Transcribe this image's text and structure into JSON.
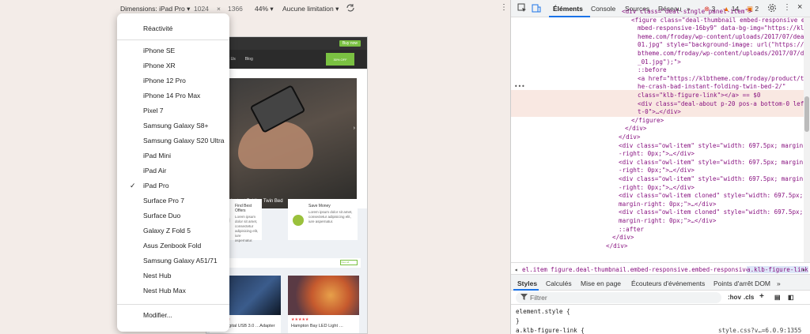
{
  "toolbar": {
    "dimensions_label": "Dimensions: iPad Pro",
    "width": "1024",
    "times": "×",
    "height": "1366",
    "zoom": "44%",
    "throttle": "Aucune limitation"
  },
  "menu": {
    "items": [
      "Réactivité",
      "iPhone SE",
      "iPhone XR",
      "iPhone 12 Pro",
      "iPhone 14 Pro Max",
      "Pixel 7",
      "Samsung Galaxy S8+",
      "Samsung Galaxy S20 Ultra",
      "iPad Mini",
      "iPad Air",
      "iPad Pro",
      "Surface Pro 7",
      "Surface Duo",
      "Galaxy Z Fold 5",
      "Asus Zenbook Fold",
      "Samsung Galaxy A51/71",
      "Nest Hub",
      "Nest Hub Max",
      "Modifier..."
    ],
    "selected": "iPad Pro",
    "check": "✓"
  },
  "site": {
    "buy": "Buy now",
    "nav": [
      "Contact Us",
      "Blog"
    ],
    "offer": "30% OFF",
    "hero_caption": "d Instant Folding Twin Bed",
    "cards": [
      {
        "title": "Find Best Offers",
        "body": "Lorem ipsum dolor sit amet, consectetur adipisicing elit, iure aspernatur."
      },
      {
        "title": "Save Money",
        "body": "Lorem ipsum dolor sit amet, consectetur adipisicing elit, iure aspernatur."
      }
    ],
    "view_all": "View all",
    "products": [
      {
        "stars": "★★★★★",
        "name": "…ern Digital USB 3.0 …Adapter"
      },
      {
        "stars": "★★★★★",
        "name": "Hampton Bay LED Light …"
      }
    ]
  },
  "devtools": {
    "tabs": [
      "Éléments",
      "Console",
      "Sources",
      "Réseau"
    ],
    "more": "»",
    "badges": {
      "errors": "3",
      "warnings": "14",
      "messages": "2"
    },
    "code_lines": [
      {
        "t": "<div class=\"deal-single panel-item\">",
        "indent": 140
      },
      {
        "t": "<figure class=\"deal-thumbnail embed-responsive e",
        "indent": 152
      },
      {
        "t": "mbed-responsive-16by9\" data-bg-img=\"https://klbt",
        "indent": 160
      },
      {
        "t": "heme.com/froday/wp-content/uploads/2017/07/deal_",
        "indent": 160
      },
      {
        "t": "01.jpg\" style=\"background-image: url(\"https://kl",
        "indent": 160
      },
      {
        "t": "btheme.com/froday/wp-content/uploads/2017/07/deal",
        "indent": 160
      },
      {
        "t": "_01.jpg\");\">",
        "indent": 160
      },
      {
        "t": "::before",
        "indent": 160
      },
      {
        "t": "<a href=\"https://klbtheme.com/froday/product/t",
        "indent": 160
      },
      {
        "t": "he-crash-bad-instant-folding-twin-bed-2/\"",
        "indent": 160
      },
      {
        "t": "class=\"klb-figure-link\"></a> == $0",
        "indent": 160
      },
      {
        "t": "<div class=\"deal-about p-20 pos-a bottom-0 lef",
        "indent": 160
      },
      {
        "t": "t-0\">…</div>",
        "indent": 160
      },
      {
        "t": "</figure>",
        "indent": 152
      },
      {
        "t": "</div>",
        "indent": 144
      },
      {
        "t": "</div>",
        "indent": 136
      },
      {
        "t": "<div class=\"owl-item\" style=\"width: 697.5px; margin",
        "indent": 136
      },
      {
        "t": "-right: 0px;\">…</div>",
        "indent": 136
      },
      {
        "t": "<div class=\"owl-item\" style=\"width: 697.5px; margin",
        "indent": 136
      },
      {
        "t": "-right: 0px;\">…</div>",
        "indent": 136
      },
      {
        "t": "<div class=\"owl-item\" style=\"width: 697.5px; margin",
        "indent": 136
      },
      {
        "t": "-right: 0px;\">…</div>",
        "indent": 136
      },
      {
        "t": "<div class=\"owl-item cloned\" style=\"width: 697.5px;",
        "indent": 136
      },
      {
        "t": "margin-right: 0px;\">…</div>",
        "indent": 136
      },
      {
        "t": "<div class=\"owl-item cloned\" style=\"width: 697.5px;",
        "indent": 136
      },
      {
        "t": "margin-right: 0px;\">…</div>",
        "indent": 136
      },
      {
        "t": "::after",
        "indent": 136
      },
      {
        "t": "</div>",
        "indent": 128
      },
      {
        "t": "</div>",
        "indent": 120
      }
    ],
    "breadcrumb": [
      "el.item",
      "figure.deal-thumbnail.embed-responsive.embed-responsive-16by9",
      "a.klb-figure-link"
    ],
    "styles_tabs": [
      "Styles",
      "Calculés",
      "Mise en page",
      "Écouteurs d'événements",
      "Points d'arrêt DOM"
    ],
    "filter_placeholder": "Filtrer",
    "filter_tools": [
      ":hov",
      ".cls",
      "+"
    ],
    "rules": [
      {
        "l": "element.style {"
      },
      {
        "l": "}"
      },
      {
        "l": "a.klb-figure-link {",
        "src": "style.css?v…=6.0.9:1355"
      }
    ]
  }
}
